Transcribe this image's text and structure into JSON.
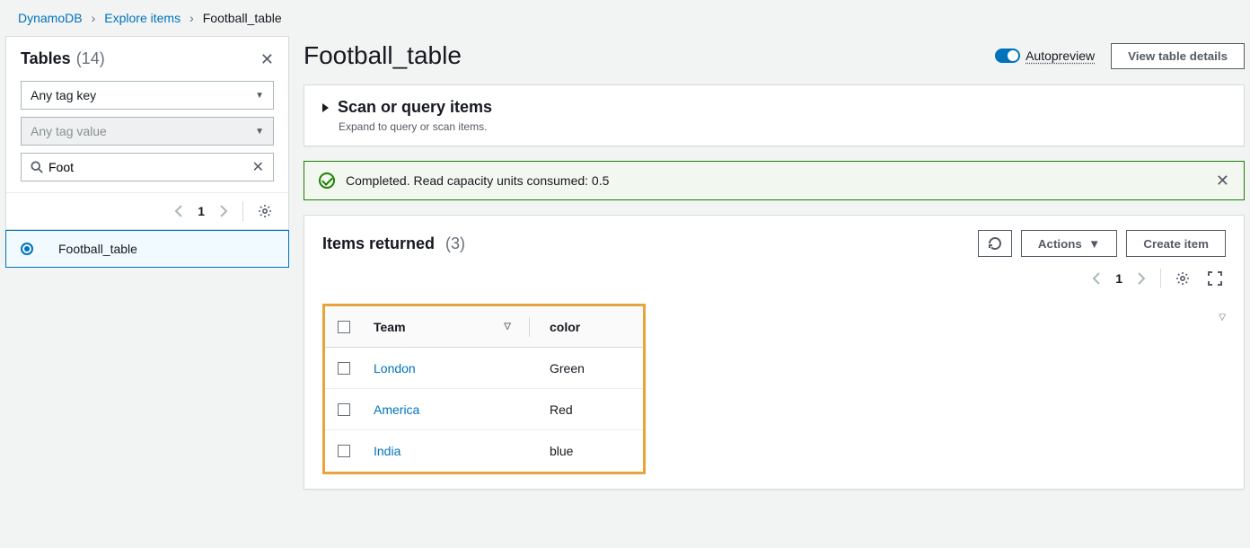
{
  "breadcrumb": {
    "root": "DynamoDB",
    "mid": "Explore items",
    "current": "Football_table"
  },
  "sidebar": {
    "title": "Tables",
    "count": "(14)",
    "tag_key": "Any tag key",
    "tag_value": "Any tag value",
    "search_value": "Foot",
    "page": "1",
    "selected_table": "Football_table"
  },
  "main": {
    "title": "Football_table",
    "autopreview": "Autopreview",
    "view_details": "View table details",
    "scan_title": "Scan or query items",
    "scan_sub": "Expand to query or scan items.",
    "alert": "Completed. Read capacity units consumed: 0.5",
    "items_title": "Items returned",
    "items_count": "(3)",
    "actions_label": "Actions",
    "create_label": "Create item",
    "items_page": "1",
    "headers": {
      "team": "Team",
      "color": "color"
    },
    "rows": [
      {
        "team": "London",
        "color": "Green"
      },
      {
        "team": "America",
        "color": "Red"
      },
      {
        "team": "India",
        "color": "blue"
      }
    ]
  }
}
